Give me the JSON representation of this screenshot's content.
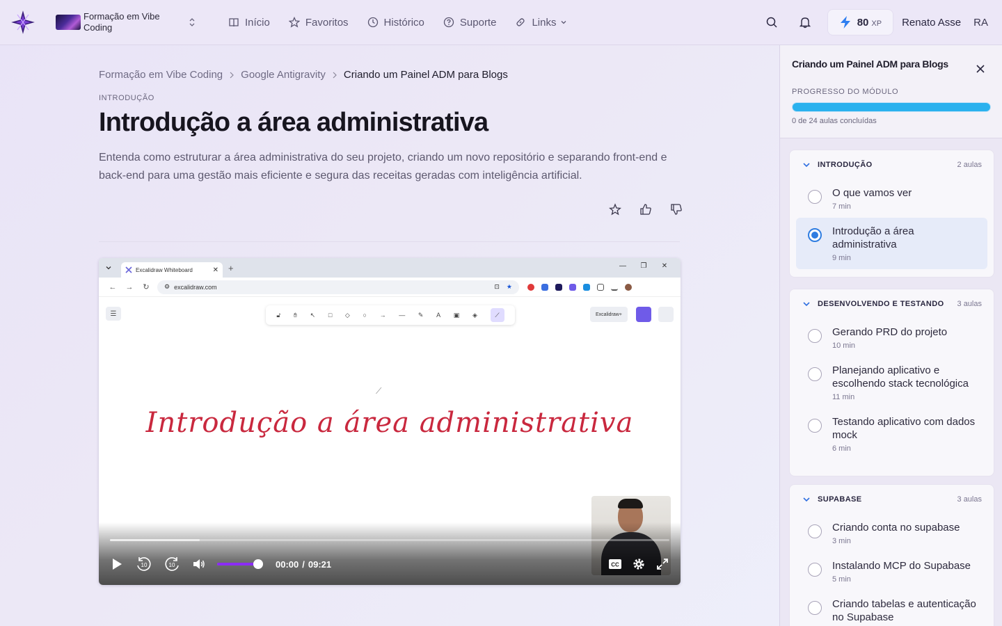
{
  "header": {
    "course_name": "Formação em Vibe Coding",
    "nav": [
      {
        "label": "Início",
        "icon": "book-icon"
      },
      {
        "label": "Favoritos",
        "icon": "star-icon"
      },
      {
        "label": "Histórico",
        "icon": "clock-icon"
      },
      {
        "label": "Suporte",
        "icon": "help-circle-icon"
      },
      {
        "label": "Links",
        "icon": "link-icon"
      }
    ],
    "xp_value": "80",
    "xp_label": "XP",
    "user_name": "Renato Asse",
    "user_initials": "RA"
  },
  "breadcrumb": {
    "items": [
      "Formação em Vibe Coding",
      "Google Antigravity"
    ],
    "current": "Criando um Painel ADM para Blogs"
  },
  "lesson": {
    "section": "INTRODUÇÃO",
    "title": "Introdução a área administrativa",
    "description": "Entenda como estruturar a área administrativa do seu projeto, criando um novo repositório e separando front-end e back-end para uma gestão mais eficiente e segura das receitas geradas com inteligência artificial."
  },
  "video": {
    "browser_tab_title": "Excalidraw Whiteboard",
    "browser_url": "excalidraw.com",
    "library_label": "Excalidraw+",
    "canvas_text": "Introdução a área administrativa",
    "time_current": "00:00",
    "time_total": "09:21",
    "time_separator": "/",
    "skip_back_label": "10",
    "skip_forward_label": "10",
    "volume_level": 0.9,
    "played_fraction": 0.0,
    "buffered_fraction": 0.16,
    "accent_color": "#8b2cf5"
  },
  "sidebar": {
    "title": "Criando um Painel ADM para Blogs",
    "progress_label": "PROGRESSO DO MÓDULO",
    "progress_text": "0 de 24 aulas concluídas",
    "progress_fraction": 1.0,
    "progress_color": "#2ab1ee",
    "modules": [
      {
        "name": "INTRODUÇÃO",
        "count": "2 aulas",
        "lessons": [
          {
            "title": "O que vamos ver",
            "duration": "7 min",
            "active": false
          },
          {
            "title": "Introdução a área administrativa",
            "duration": "9 min",
            "active": true
          }
        ]
      },
      {
        "name": "DESENVOLVENDO E TESTANDO",
        "count": "3 aulas",
        "lessons": [
          {
            "title": "Gerando PRD do projeto",
            "duration": "10 min",
            "active": false
          },
          {
            "title": "Planejando aplicativo e escolhendo stack tecnológica",
            "duration": "11 min",
            "active": false
          },
          {
            "title": "Testando aplicativo com dados mock",
            "duration": "6 min",
            "active": false
          }
        ]
      },
      {
        "name": "SUPABASE",
        "count": "3 aulas",
        "lessons": [
          {
            "title": "Criando conta no supabase",
            "duration": "3 min",
            "active": false
          },
          {
            "title": "Instalando MCP do Supabase",
            "duration": "5 min",
            "active": false
          },
          {
            "title": "Criando tabelas e autenticação no Supabase",
            "duration": "",
            "active": false
          }
        ]
      }
    ]
  }
}
